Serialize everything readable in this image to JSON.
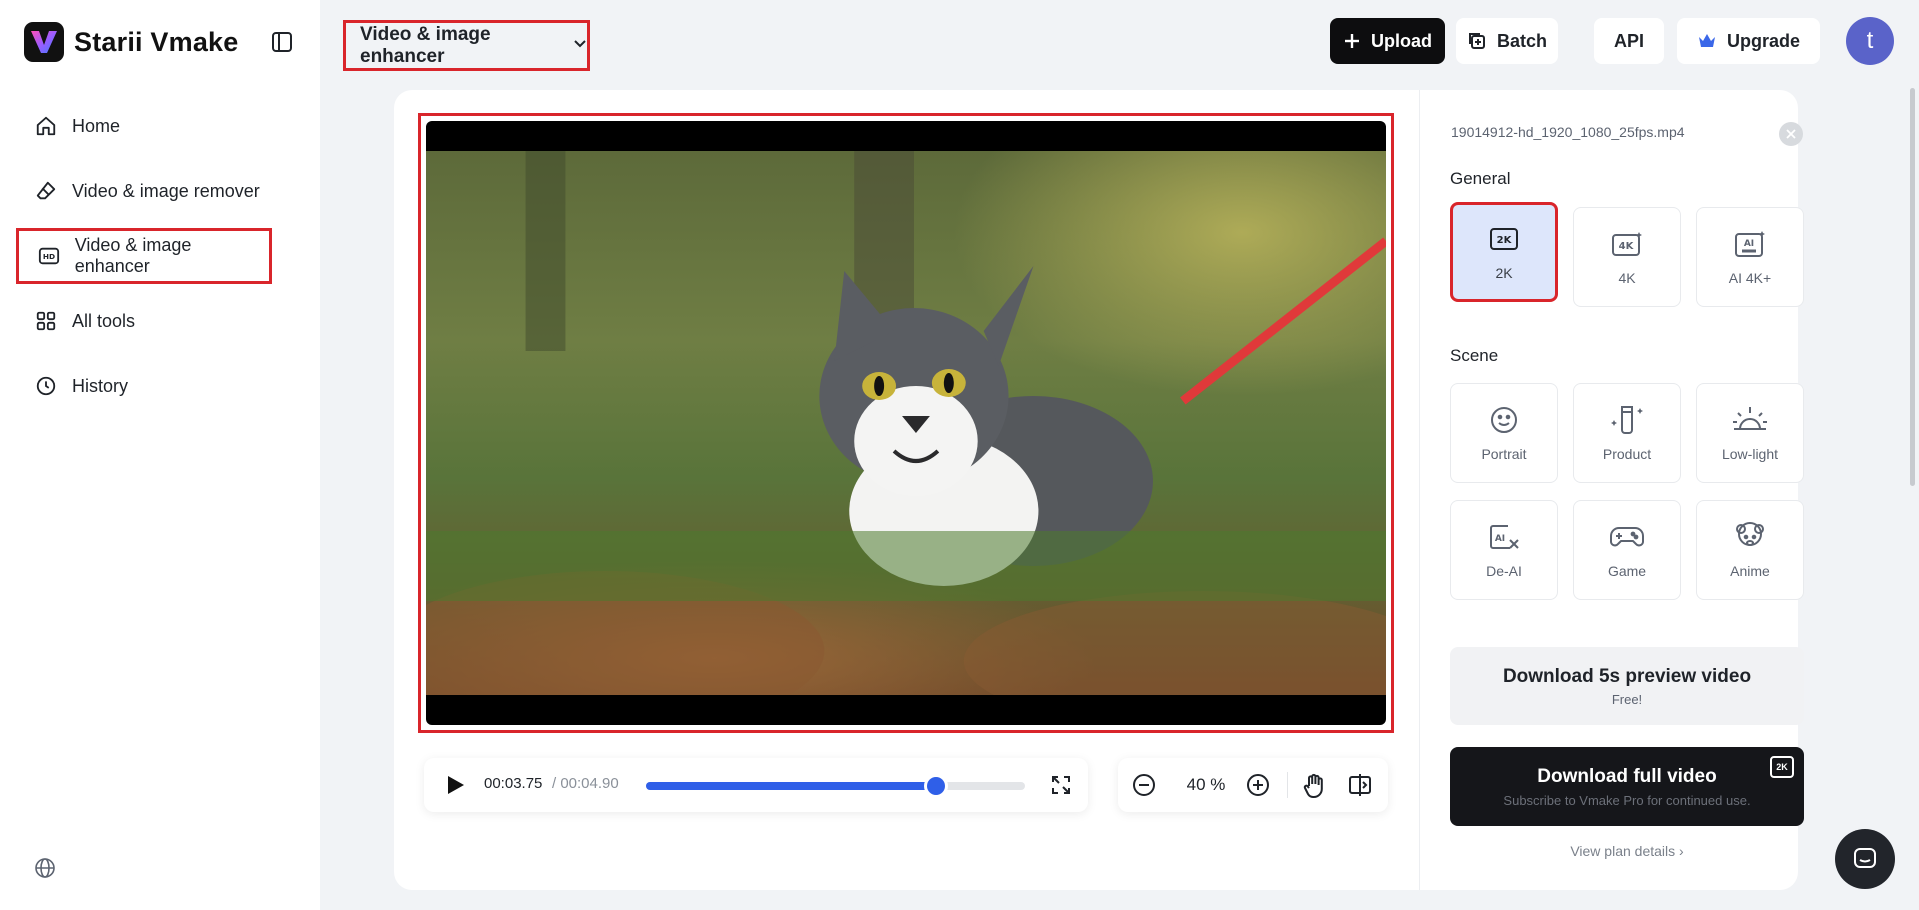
{
  "sidebar": {
    "brand": "Starii Vmake",
    "items": [
      {
        "label": "Home",
        "icon": "home-icon"
      },
      {
        "label": "Video & image remover",
        "icon": "eraser-icon"
      },
      {
        "label": "Video & image enhancer",
        "icon": "hd-icon",
        "active": true
      },
      {
        "label": "All tools",
        "icon": "grid-icon"
      },
      {
        "label": "History",
        "icon": "clock-icon"
      }
    ]
  },
  "header": {
    "mode": "Video & image enhancer",
    "upload": "Upload",
    "batch": "Batch",
    "api": "API",
    "upgrade": "Upgrade",
    "avatar_letter": "t"
  },
  "player": {
    "current_time": "00:03.75",
    "total_time": "/ 00:04.90",
    "progress": 0.765,
    "zoom": "40 %"
  },
  "panel": {
    "file_name": "19014912-hd_1920_1080_25fps.mp4",
    "general_title": "General",
    "general": [
      {
        "label": "2K",
        "icon": "2k-icon",
        "selected": true
      },
      {
        "label": "4K",
        "icon": "4k-icon"
      },
      {
        "label": "AI 4K+",
        "icon": "ai-4k-icon"
      }
    ],
    "scene_title": "Scene",
    "scenes": [
      {
        "label": "Portrait",
        "icon": "smile-icon"
      },
      {
        "label": "Product",
        "icon": "product-icon"
      },
      {
        "label": "Low-light",
        "icon": "sunrise-icon"
      },
      {
        "label": "De-AI",
        "icon": "de-ai-icon"
      },
      {
        "label": "Game",
        "icon": "gamepad-icon"
      },
      {
        "label": "Anime",
        "icon": "bear-icon"
      }
    ],
    "download_preview": {
      "title": "Download 5s preview video",
      "sub": "Free!"
    },
    "download_full": {
      "title": "Download full video",
      "sub": "Subscribe to Vmake Pro for continued use.",
      "badge": "2K"
    },
    "plan_link": "View plan details ›"
  },
  "colors": {
    "accent": "#2f5fe8",
    "highlight": "#d9252b",
    "avatar": "#5a63c9"
  }
}
